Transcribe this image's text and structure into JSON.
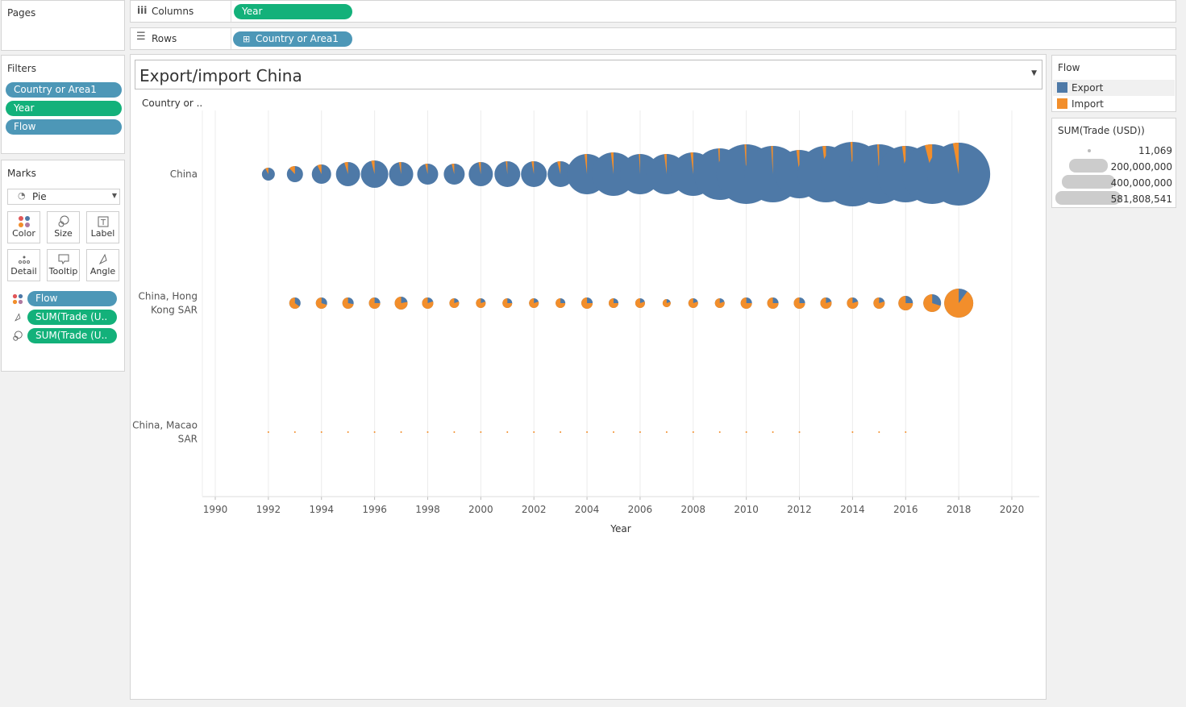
{
  "shelves": {
    "pages_title": "Pages",
    "columns_label": "Columns",
    "columns_pill": "Year",
    "rows_label": "Rows",
    "rows_pill": "Country or Area1"
  },
  "filters": {
    "title": "Filters",
    "items": [
      "Country or Area1",
      "Year",
      "Flow"
    ]
  },
  "marks": {
    "title": "Marks",
    "type": "Pie",
    "buttons": [
      "Color",
      "Size",
      "Label",
      "Detail",
      "Tooltip",
      "Angle"
    ],
    "fields": [
      "Flow",
      "SUM(Trade (U..",
      "SUM(Trade (U.."
    ]
  },
  "view": {
    "title": "Export/import China",
    "row_header": "Country or .."
  },
  "legend_flow": {
    "title": "Flow",
    "items": [
      {
        "label": "Export",
        "color": "#4e79a7"
      },
      {
        "label": "Import",
        "color": "#f28e2b"
      }
    ]
  },
  "legend_size": {
    "title": "SUM(Trade (USD))",
    "items": [
      "11,069",
      "200,000,000",
      "400,000,000",
      "581,808,541"
    ]
  },
  "chart_data": {
    "type": "pie",
    "mark": "pie per year and country, size = SUM(Trade (USD)), slice = Flow",
    "xlabel": "Year",
    "xlim": [
      1990,
      2020
    ],
    "xticks": [
      "1990",
      "1992",
      "1994",
      "1996",
      "1998",
      "2000",
      "2002",
      "2004",
      "2006",
      "2008",
      "2010",
      "2012",
      "2014",
      "2016",
      "2018",
      "2020"
    ],
    "rows": [
      "China",
      "China, Hong Kong SAR",
      "China, Macao SAR"
    ],
    "series_colors": {
      "Export": "#4e79a7",
      "Import": "#f28e2b"
    },
    "data": [
      {
        "country": "China",
        "points": [
          {
            "year": 1992,
            "size": 8,
            "import_share": 0.08
          },
          {
            "year": 1993,
            "size": 10,
            "import_share": 0.12
          },
          {
            "year": 1994,
            "size": 12,
            "import_share": 0.07
          },
          {
            "year": 1995,
            "size": 15,
            "import_share": 0.05
          },
          {
            "year": 1996,
            "size": 17,
            "import_share": 0.04
          },
          {
            "year": 1997,
            "size": 15,
            "import_share": 0.03
          },
          {
            "year": 1998,
            "size": 13,
            "import_share": 0.04
          },
          {
            "year": 1999,
            "size": 13,
            "import_share": 0.04
          },
          {
            "year": 2000,
            "size": 15,
            "import_share": 0.03
          },
          {
            "year": 2001,
            "size": 16,
            "import_share": 0.02
          },
          {
            "year": 2002,
            "size": 16,
            "import_share": 0.03
          },
          {
            "year": 2003,
            "size": 16,
            "import_share": 0.04
          },
          {
            "year": 2004,
            "size": 25,
            "import_share": 0.02
          },
          {
            "year": 2005,
            "size": 27,
            "import_share": 0.02
          },
          {
            "year": 2006,
            "size": 25,
            "import_share": 0.01
          },
          {
            "year": 2007,
            "size": 25,
            "import_share": 0.02
          },
          {
            "year": 2008,
            "size": 27,
            "import_share": 0.02
          },
          {
            "year": 2009,
            "size": 32,
            "import_share": 0.01
          },
          {
            "year": 2010,
            "size": 37,
            "import_share": 0.01
          },
          {
            "year": 2011,
            "size": 35,
            "import_share": 0.01
          },
          {
            "year": 2012,
            "size": 30,
            "import_share": 0.02
          },
          {
            "year": 2013,
            "size": 35,
            "import_share": 0.02
          },
          {
            "year": 2014,
            "size": 40,
            "import_share": 0.01
          },
          {
            "year": 2015,
            "size": 37,
            "import_share": 0.01
          },
          {
            "year": 2016,
            "size": 35,
            "import_share": 0.02
          },
          {
            "year": 2017,
            "size": 37,
            "import_share": 0.04
          },
          {
            "year": 2018,
            "size": 39,
            "import_share": 0.03
          }
        ]
      },
      {
        "country": "China, Hong Kong SAR",
        "points": [
          {
            "year": 1993,
            "size": 7,
            "import_share": 0.65
          },
          {
            "year": 1994,
            "size": 7,
            "import_share": 0.7
          },
          {
            "year": 1995,
            "size": 7,
            "import_share": 0.72
          },
          {
            "year": 1996,
            "size": 7,
            "import_share": 0.75
          },
          {
            "year": 1997,
            "size": 8,
            "import_share": 0.78
          },
          {
            "year": 1998,
            "size": 7,
            "import_share": 0.8
          },
          {
            "year": 1999,
            "size": 6,
            "import_share": 0.8
          },
          {
            "year": 2000,
            "size": 6,
            "import_share": 0.8
          },
          {
            "year": 2001,
            "size": 6,
            "import_share": 0.75
          },
          {
            "year": 2002,
            "size": 6,
            "import_share": 0.8
          },
          {
            "year": 2003,
            "size": 6,
            "import_share": 0.75
          },
          {
            "year": 2004,
            "size": 7,
            "import_share": 0.75
          },
          {
            "year": 2005,
            "size": 6,
            "import_share": 0.75
          },
          {
            "year": 2006,
            "size": 6,
            "import_share": 0.8
          },
          {
            "year": 2007,
            "size": 5,
            "import_share": 0.8
          },
          {
            "year": 2008,
            "size": 6,
            "import_share": 0.8
          },
          {
            "year": 2009,
            "size": 6,
            "import_share": 0.8
          },
          {
            "year": 2010,
            "size": 7,
            "import_share": 0.75
          },
          {
            "year": 2011,
            "size": 7,
            "import_share": 0.75
          },
          {
            "year": 2012,
            "size": 7,
            "import_share": 0.75
          },
          {
            "year": 2013,
            "size": 7,
            "import_share": 0.8
          },
          {
            "year": 2014,
            "size": 7,
            "import_share": 0.8
          },
          {
            "year": 2015,
            "size": 7,
            "import_share": 0.8
          },
          {
            "year": 2016,
            "size": 9,
            "import_share": 0.75
          },
          {
            "year": 2017,
            "size": 11,
            "import_share": 0.7
          },
          {
            "year": 2018,
            "size": 18,
            "import_share": 0.9
          }
        ]
      },
      {
        "country": "China, Macao SAR",
        "points": [
          {
            "year": 1992,
            "size": 1,
            "import_share": 1
          },
          {
            "year": 1993,
            "size": 1,
            "import_share": 1
          },
          {
            "year": 1994,
            "size": 1,
            "import_share": 1
          },
          {
            "year": 1995,
            "size": 1,
            "import_share": 1
          },
          {
            "year": 1996,
            "size": 1,
            "import_share": 1
          },
          {
            "year": 1997,
            "size": 1,
            "import_share": 1
          },
          {
            "year": 1998,
            "size": 1,
            "import_share": 1
          },
          {
            "year": 1999,
            "size": 1,
            "import_share": 1
          },
          {
            "year": 2000,
            "size": 1,
            "import_share": 1
          },
          {
            "year": 2001,
            "size": 1,
            "import_share": 1
          },
          {
            "year": 2002,
            "size": 1,
            "import_share": 1
          },
          {
            "year": 2003,
            "size": 1,
            "import_share": 1
          },
          {
            "year": 2004,
            "size": 1,
            "import_share": 1
          },
          {
            "year": 2005,
            "size": 1,
            "import_share": 1
          },
          {
            "year": 2006,
            "size": 1,
            "import_share": 1
          },
          {
            "year": 2007,
            "size": 1,
            "import_share": 1
          },
          {
            "year": 2008,
            "size": 1,
            "import_share": 1
          },
          {
            "year": 2009,
            "size": 1,
            "import_share": 1
          },
          {
            "year": 2010,
            "size": 1,
            "import_share": 1
          },
          {
            "year": 2011,
            "size": 1,
            "import_share": 1
          },
          {
            "year": 2012,
            "size": 1,
            "import_share": 1
          },
          {
            "year": 2014,
            "size": 1,
            "import_share": 1
          },
          {
            "year": 2015,
            "size": 1,
            "import_share": 1
          },
          {
            "year": 2016,
            "size": 1,
            "import_share": 1
          }
        ]
      }
    ]
  }
}
